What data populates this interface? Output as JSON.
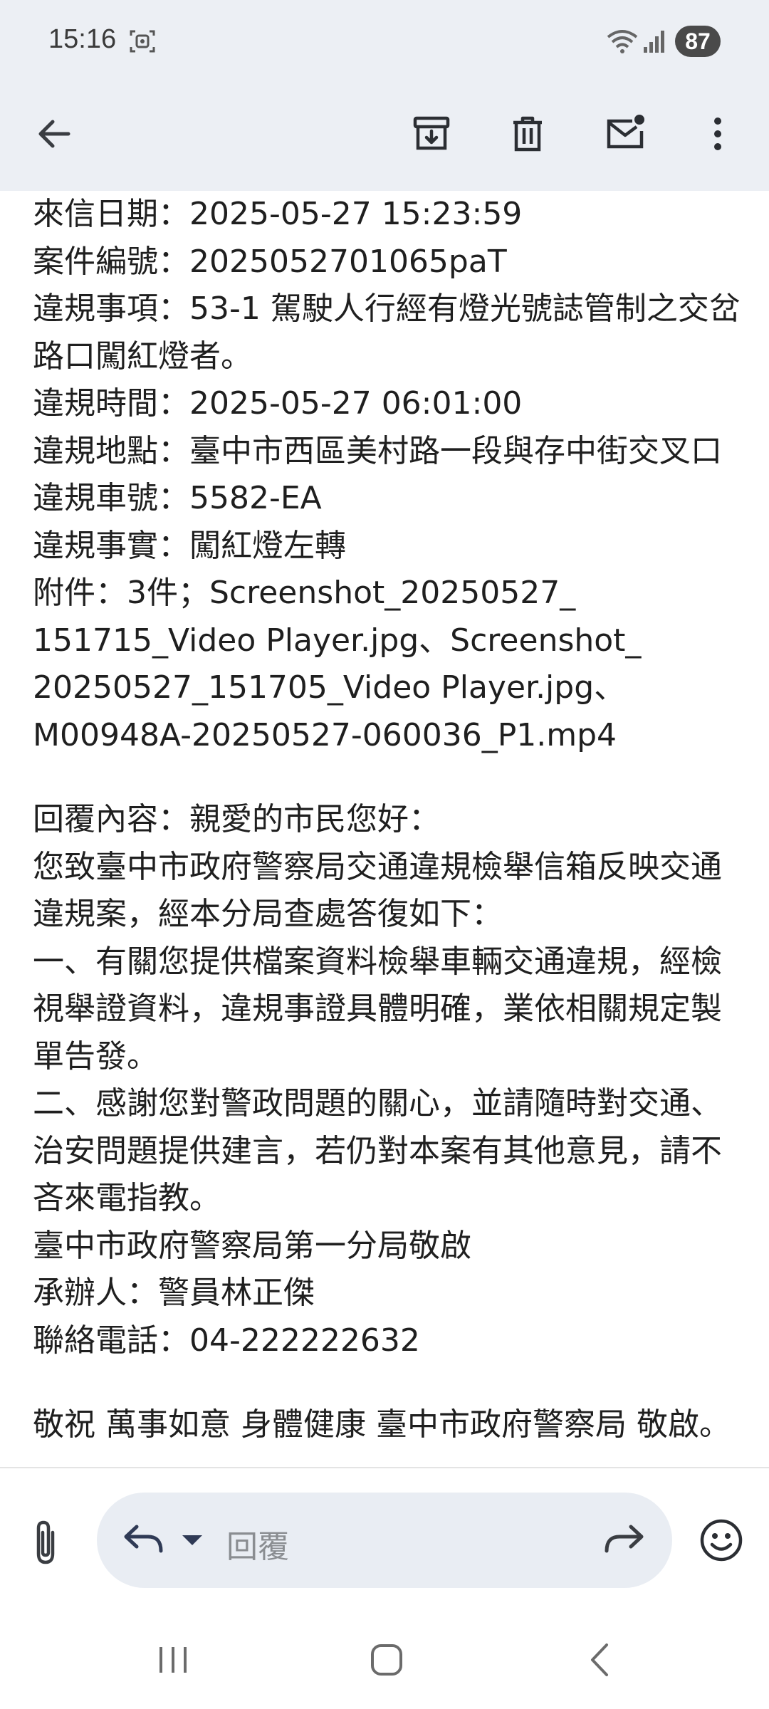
{
  "status_bar": {
    "time": "15:16",
    "battery": "87"
  },
  "toolbar": {
    "icons": [
      "back-arrow-icon",
      "archive-icon",
      "delete-icon",
      "mark-unread-icon",
      "more-icon"
    ]
  },
  "email_body": {
    "lines": [
      "來信日期：2025-05-27 15:23:59",
      "案件編號：2025052701065paT",
      "違規事項：53-1 駕駛人行經有燈光號誌管制之交岔",
      "路口闖紅燈者。",
      "違規時間：2025-05-27 06:01:00",
      "違規地點：臺中市西區美村路一段與存中街交叉口",
      "違規車號：5582-EA",
      "違規事實：闖紅燈左轉",
      "附件：3件；Screenshot_20250527_",
      "151715_Video Player.jpg、Screenshot_",
      "20250527_151705_Video Player.jpg、",
      "M00948A-20250527-060036_P1.mp4"
    ],
    "reply_lines": [
      "回覆內容：親愛的市民您好：",
      "您致臺中市政府警察局交通違規檢舉信箱反映交通",
      "違規案，經本分局查處答復如下：",
      "一、有關您提供檔案資料檢舉車輛交通違規，經檢",
      "視舉證資料，違規事證具體明確，業依相關規定製",
      "單告發。",
      "二、感謝您對警政問題的關心，並請隨時對交通、",
      "治安問題提供建言，若仍對本案有其他意見，請不",
      "吝來電指教。",
      "臺中市政府警察局第一分局敬啟",
      "承辦人：警員林正傑",
      "聯絡電話：04-222222632"
    ],
    "closing": "敬祝 萬事如意 身體健康 臺中市政府警察局 敬啟。"
  },
  "reply_bar": {
    "placeholder": "回覆",
    "icons": [
      "attach-icon",
      "reply-icon",
      "reply-options-icon",
      "forward-icon",
      "emoji-icon"
    ]
  },
  "nav_bar": {
    "icons": [
      "recent-apps-icon",
      "home-icon",
      "back-icon"
    ]
  }
}
